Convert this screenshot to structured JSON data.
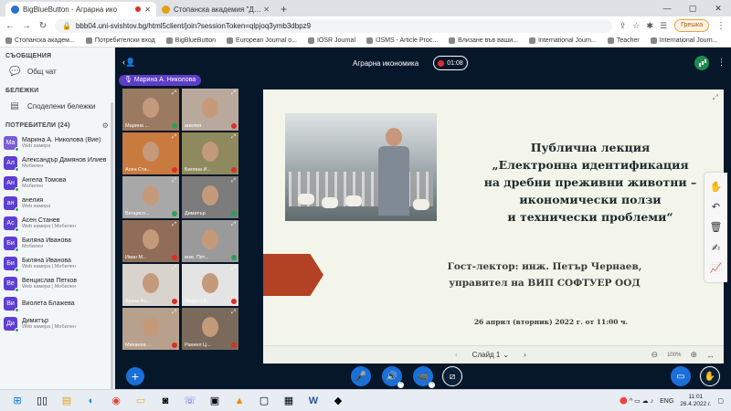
{
  "browser": {
    "tabs": [
      {
        "label": "BigBlueButton - Аграрна ико",
        "active": true,
        "recording": true
      },
      {
        "label": "Стопанска академия \"Димитър",
        "active": false
      }
    ],
    "new_tab": "+",
    "window_controls": [
      "—",
      "▢",
      "✕"
    ],
    "address": "bbb04.uni-svishtov.bg/html5client/join?sessionToken=qlpjoq3ymb3dbpz9",
    "error_badge": "Грешка",
    "bookmarks": [
      "Стопанска академ...",
      "Потребителски вход",
      "BigBlueButton",
      "European Journal o...",
      "IOSR Journal",
      "IJSMS - Article Proc...",
      "Влизане във ваши...",
      "International Journ...",
      "Teacher",
      "International Journ..."
    ]
  },
  "sidebar": {
    "messages_title": "СЪОБЩЕНИЯ",
    "public_chat": "Общ чат",
    "notes_title": "БЕЛЕЖКИ",
    "shared_notes": "Споделени бележки",
    "users_title": "ПОТРЕБИТЕЛИ (24)",
    "users": [
      {
        "initials": "Ма",
        "name": "Марина А. Николова (Вие)",
        "sub": "Web камера",
        "presenter": true
      },
      {
        "initials": "Ал",
        "name": "Александър Дамянов Илиев",
        "sub": "Мобилен",
        "presenter": false
      },
      {
        "initials": "Ан",
        "name": "Ангела Томова",
        "sub": "Мобилен",
        "presenter": false
      },
      {
        "initials": "ан",
        "name": "анелия",
        "sub": "Web камера",
        "presenter": false
      },
      {
        "initials": "Ас",
        "name": "Асен Станев",
        "sub": "Web камера | Мобилен",
        "presenter": false
      },
      {
        "initials": "Би",
        "name": "Биляна Иванова",
        "sub": "Мобилен",
        "presenter": false
      },
      {
        "initials": "Би",
        "name": "Биляна Иванова",
        "sub": "Web камера | Мобилен",
        "presenter": false
      },
      {
        "initials": "Ве",
        "name": "Венцислав Петков",
        "sub": "Web камера | Мобилен",
        "presenter": false
      },
      {
        "initials": "Ви",
        "name": "Виолета Блажева",
        "sub": "",
        "presenter": false
      },
      {
        "initials": "Ди",
        "name": "Димитър",
        "sub": "Web камера | Мобилен",
        "presenter": false
      }
    ]
  },
  "meeting": {
    "title": "Аграрна икономика",
    "timer": "01:08",
    "talker": "Марина А. Николова"
  },
  "videos": [
    {
      "name": "Марина ...",
      "muted": false
    },
    {
      "name": "анелия",
      "muted": true
    },
    {
      "name": "Асен Ста...",
      "muted": true
    },
    {
      "name": "Биляна И...",
      "muted": true
    },
    {
      "name": "Венцисл...",
      "muted": false
    },
    {
      "name": "Димитър",
      "muted": false
    },
    {
      "name": "Иван М...",
      "muted": true
    },
    {
      "name": "инж. Пет...",
      "muted": false
    },
    {
      "name": "Луиза Ан...",
      "muted": true
    },
    {
      "name": "Маруся В...",
      "muted": true
    },
    {
      "name": "Михаела ...",
      "muted": true
    },
    {
      "name": "Рахиел Ц...",
      "muted": true
    }
  ],
  "slide": {
    "title_lines": [
      "Публична лекция",
      "„Електронна идентификация",
      "на дребни преживни животни –",
      "икономически ползи",
      "и технически проблеми“"
    ],
    "guest_lines": [
      "Гост-лектор: инж. Петър Чернаев,",
      "управител на ВИП СОФТУЕР ООД"
    ],
    "date": "26 април (вторник) 2022 г. от 11:00 ч.",
    "slide_label": "Слайд 1",
    "zoom": "100%"
  },
  "taskbar": {
    "lang": "ENG",
    "time": "11:01",
    "date": "26.4.2022 г."
  }
}
